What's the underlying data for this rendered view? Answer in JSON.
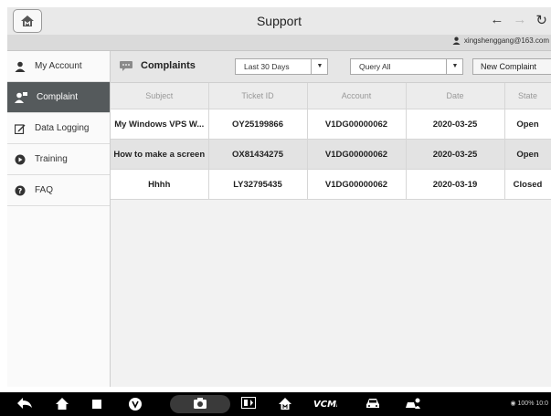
{
  "header": {
    "title": "Support"
  },
  "user": {
    "email": "xingshenggang@163.com"
  },
  "sidebar": {
    "items": [
      {
        "label": "My Account",
        "icon": "person-icon"
      },
      {
        "label": "Complaint",
        "icon": "complaint-icon",
        "active": true
      },
      {
        "label": "Data Logging",
        "icon": "edit-icon"
      },
      {
        "label": "Training",
        "icon": "play-icon"
      },
      {
        "label": "FAQ",
        "icon": "question-icon"
      }
    ]
  },
  "toolbar": {
    "title": "Complaints",
    "period_select": "Last 30 Days",
    "query_select": "Query All",
    "new_button": "New Complaint"
  },
  "table": {
    "columns": [
      "Subject",
      "Ticket ID",
      "Account",
      "Date",
      "State"
    ],
    "rows": [
      [
        "My Windows VPS W...",
        "OY25199866",
        "V1DG00000062",
        "2020-03-25",
        "Open"
      ],
      [
        "How to make a screen",
        "OX81434275",
        "V1DG00000062",
        "2020-03-25",
        "Open"
      ],
      [
        "Hhhh",
        "LY32795435",
        "V1DG00000062",
        "2020-03-19",
        "Closed"
      ]
    ]
  },
  "statusbar": {
    "text": "100% 10:0"
  },
  "colors": {
    "active_sidebar": "#555a5c",
    "content_bg": "#f2f2f2",
    "bottom_bar": "#000000"
  }
}
